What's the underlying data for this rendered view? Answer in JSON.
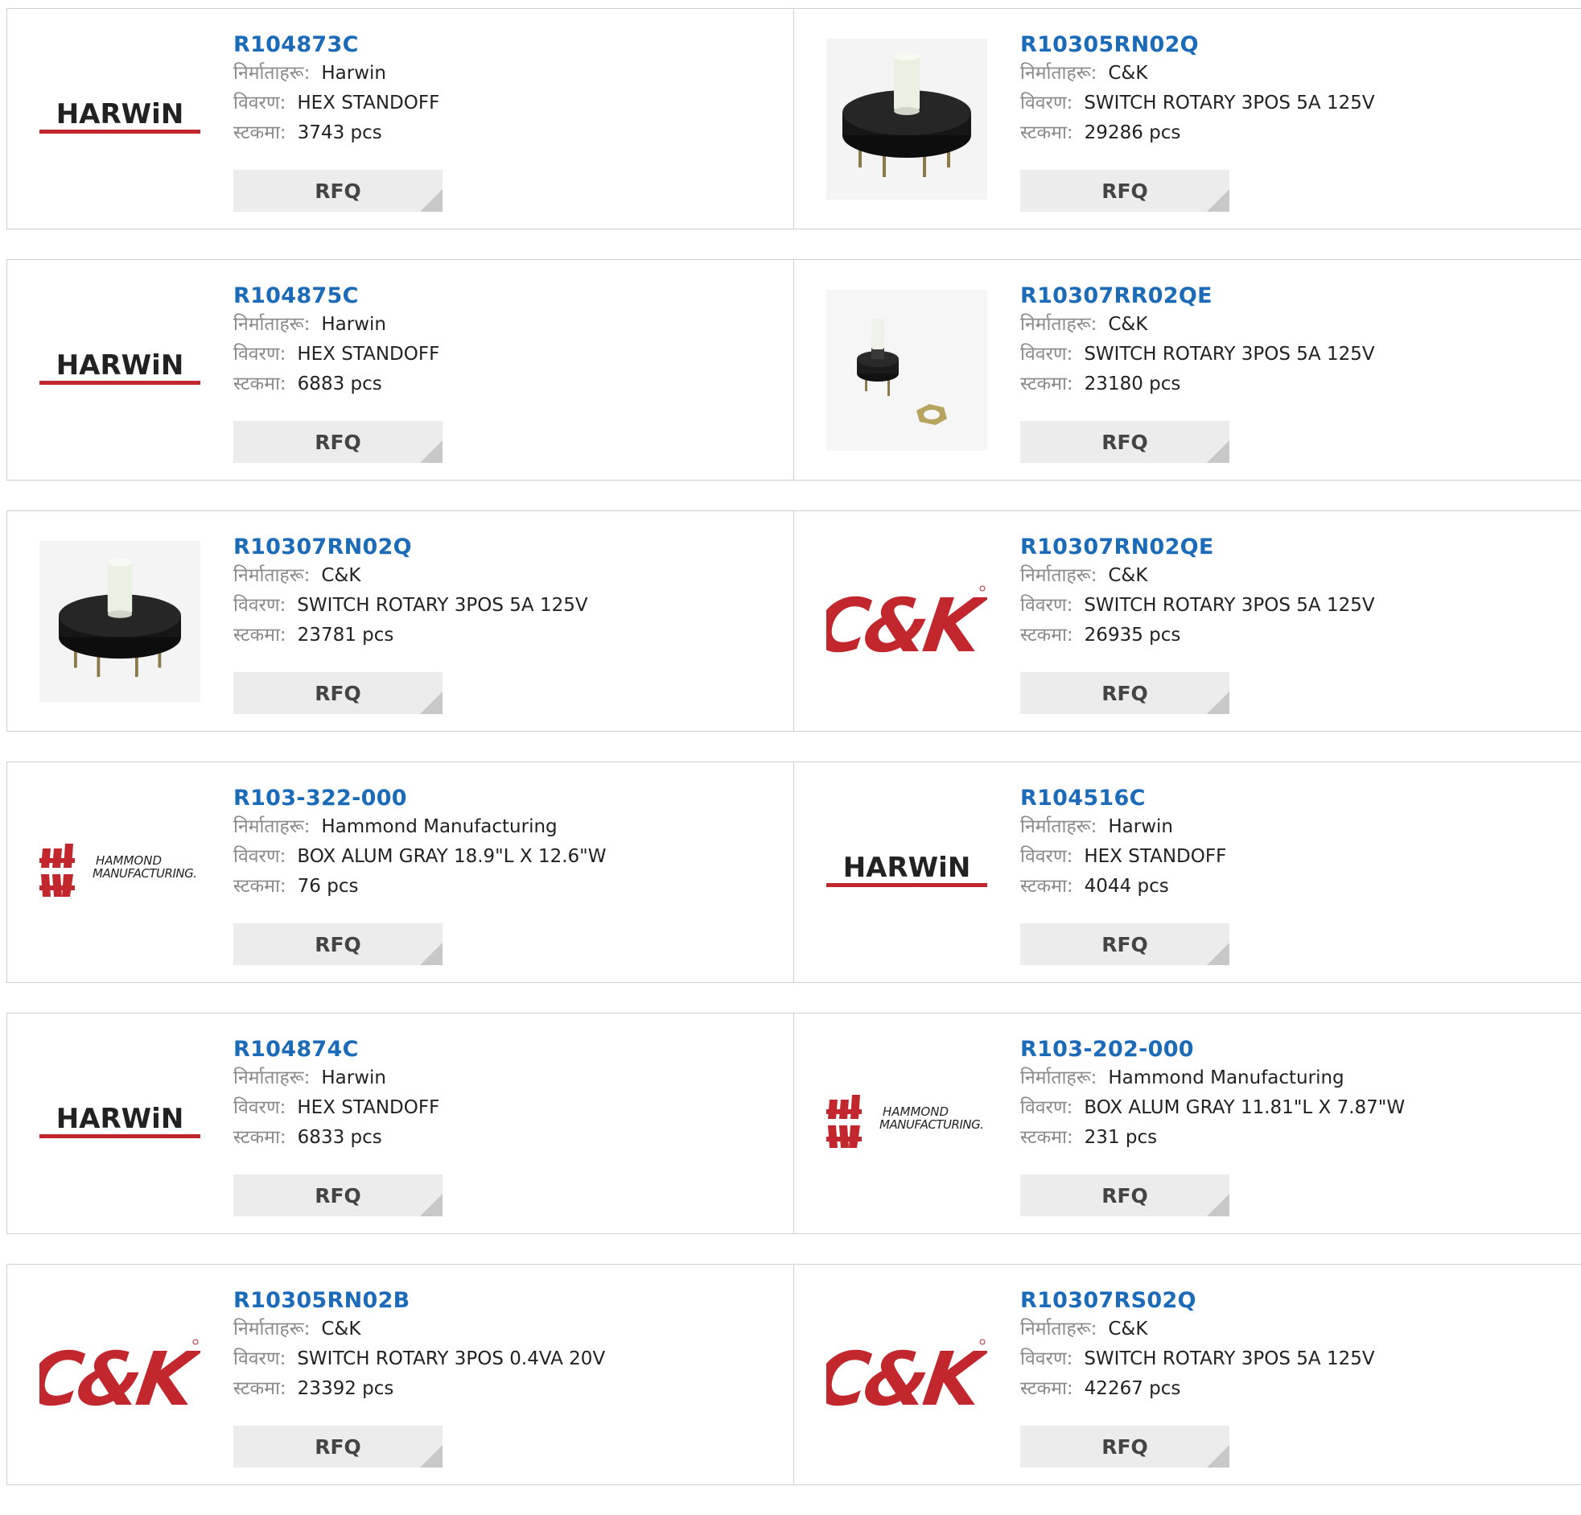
{
  "labels": {
    "manufacturer": "निर्माताहरू:",
    "description": "विवरण:",
    "stock": "स्टकमा:",
    "rfq": "RFQ"
  },
  "colors": {
    "link": "#1c6bb8",
    "brand_red": "#c1272d",
    "button_bg": "#ececec"
  },
  "logos": {
    "harwin": "HARWiN",
    "ck": "C&K",
    "hammond_line1": "HAMMOND",
    "hammond_line2": "MANUFACTURING."
  },
  "products": [
    {
      "part": "R104873C",
      "manufacturer": "Harwin",
      "description": "HEX STANDOFF",
      "stock": "3743 pcs",
      "image": "harwin-logo"
    },
    {
      "part": "R10305RN02Q",
      "manufacturer": "C&K",
      "description": "SWITCH ROTARY 3POS 5A 125V",
      "stock": "29286 pcs",
      "image": "rotary-switch-photo"
    },
    {
      "part": "R104875C",
      "manufacturer": "Harwin",
      "description": "HEX STANDOFF",
      "stock": "6883 pcs",
      "image": "harwin-logo"
    },
    {
      "part": "R10307RR02QE",
      "manufacturer": "C&K",
      "description": "SWITCH ROTARY 3POS 5A 125V",
      "stock": "23180 pcs",
      "image": "rotary-switch-small-photo"
    },
    {
      "part": "R10307RN02Q",
      "manufacturer": "C&K",
      "description": "SWITCH ROTARY 3POS 5A 125V",
      "stock": "23781 pcs",
      "image": "rotary-switch-tall-photo"
    },
    {
      "part": "R10307RN02QE",
      "manufacturer": "C&K",
      "description": "SWITCH ROTARY 3POS 5A 125V",
      "stock": "26935 pcs",
      "image": "ck-logo"
    },
    {
      "part": "R103-322-000",
      "manufacturer": "Hammond Manufacturing",
      "description": "BOX ALUM GRAY 18.9\"L X 12.6\"W",
      "stock": "76 pcs",
      "image": "hammond-logo"
    },
    {
      "part": "R104516C",
      "manufacturer": "Harwin",
      "description": "HEX STANDOFF",
      "stock": "4044 pcs",
      "image": "harwin-logo"
    },
    {
      "part": "R104874C",
      "manufacturer": "Harwin",
      "description": "HEX STANDOFF",
      "stock": "6833 pcs",
      "image": "harwin-logo"
    },
    {
      "part": "R103-202-000",
      "manufacturer": "Hammond Manufacturing",
      "description": "BOX ALUM GRAY 11.81\"L X 7.87\"W",
      "stock": "231 pcs",
      "image": "hammond-logo"
    },
    {
      "part": "R10305RN02B",
      "manufacturer": "C&K",
      "description": "SWITCH ROTARY 3POS 0.4VA 20V",
      "stock": "23392 pcs",
      "image": "ck-logo"
    },
    {
      "part": "R10307RS02Q",
      "manufacturer": "C&K",
      "description": "SWITCH ROTARY 3POS 5A 125V",
      "stock": "42267 pcs",
      "image": "ck-logo"
    }
  ]
}
